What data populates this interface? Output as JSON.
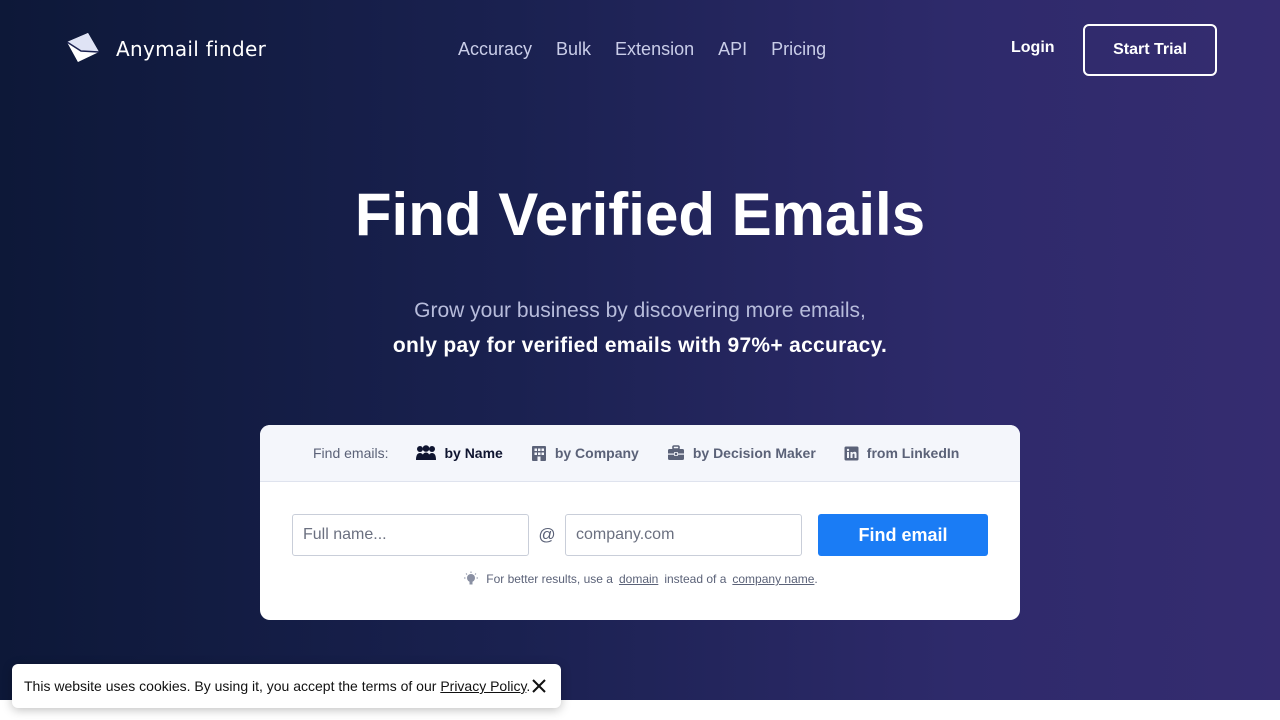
{
  "brand": {
    "name": "Anymail finder",
    "logo_icon": "envelope-icon"
  },
  "nav": {
    "items": [
      {
        "label": "Accuracy"
      },
      {
        "label": "Bulk"
      },
      {
        "label": "Extension"
      },
      {
        "label": "API"
      },
      {
        "label": "Pricing"
      }
    ],
    "login_label": "Login",
    "start_trial_label": "Start Trial"
  },
  "hero": {
    "title": "Find Verified Emails",
    "subtitle_line1": "Grow your business by discovering more emails,",
    "subtitle_line2": "only pay for verified emails with 97%+ accuracy."
  },
  "finder": {
    "tabs_label": "Find emails:",
    "tabs": [
      {
        "label": "by Name",
        "icon": "people-icon",
        "active": true
      },
      {
        "label": "by Company",
        "icon": "building-icon",
        "active": false
      },
      {
        "label": "by Decision Maker",
        "icon": "briefcase-icon",
        "active": false
      },
      {
        "label": "from LinkedIn",
        "icon": "linkedin-icon",
        "active": false
      }
    ],
    "name_placeholder": "Full name...",
    "at_symbol": "@",
    "domain_placeholder": "company.com",
    "submit_label": "Find email",
    "hint": {
      "icon": "lightbulb-icon",
      "prefix": "For better results, use a",
      "link1": "domain",
      "middle": "instead of a",
      "link2": "company name",
      "suffix": "."
    }
  },
  "cookie": {
    "text": "This website uses cookies. By using it, you accept the terms of our",
    "link": "Privacy Policy",
    "suffix": ".",
    "close_icon": "close-icon"
  },
  "colors": {
    "accent": "#1a7cf5",
    "hero_bg_start": "#0d1838",
    "hero_bg_end": "#352c70"
  }
}
